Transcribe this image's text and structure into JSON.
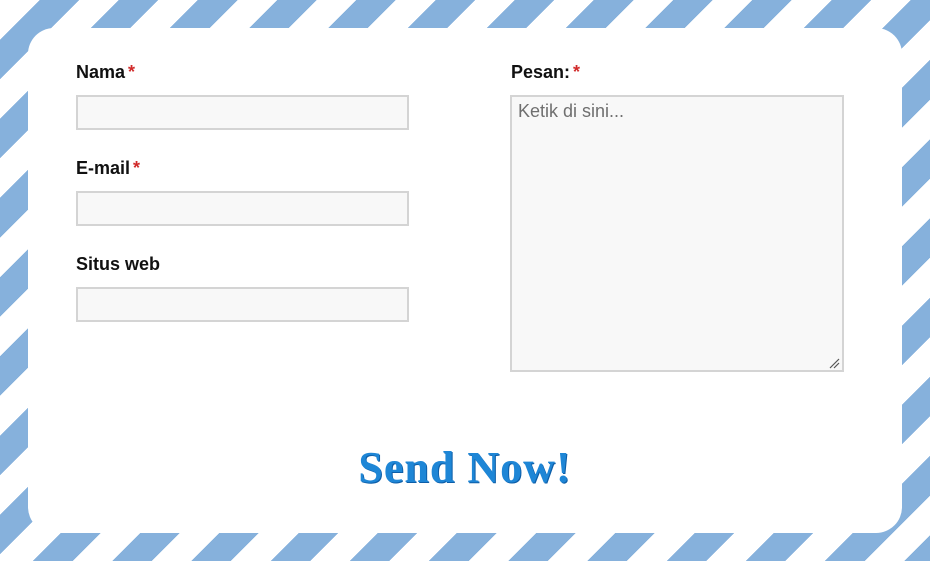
{
  "form": {
    "name": {
      "label": "Nama",
      "required_mark": "*",
      "value": ""
    },
    "email": {
      "label": "E-mail",
      "required_mark": "*",
      "value": ""
    },
    "website": {
      "label": "Situs web",
      "value": ""
    },
    "message": {
      "label": "Pesan:",
      "required_mark": "*",
      "placeholder": "Ketik di sini...",
      "value": ""
    },
    "submit_label": "Send Now!"
  },
  "colors": {
    "stripe": "#86b1dc",
    "required": "#d12a2a",
    "button_text": "#1e86d6",
    "input_border": "#d4d4d4",
    "input_bg": "#f8f8f8"
  }
}
